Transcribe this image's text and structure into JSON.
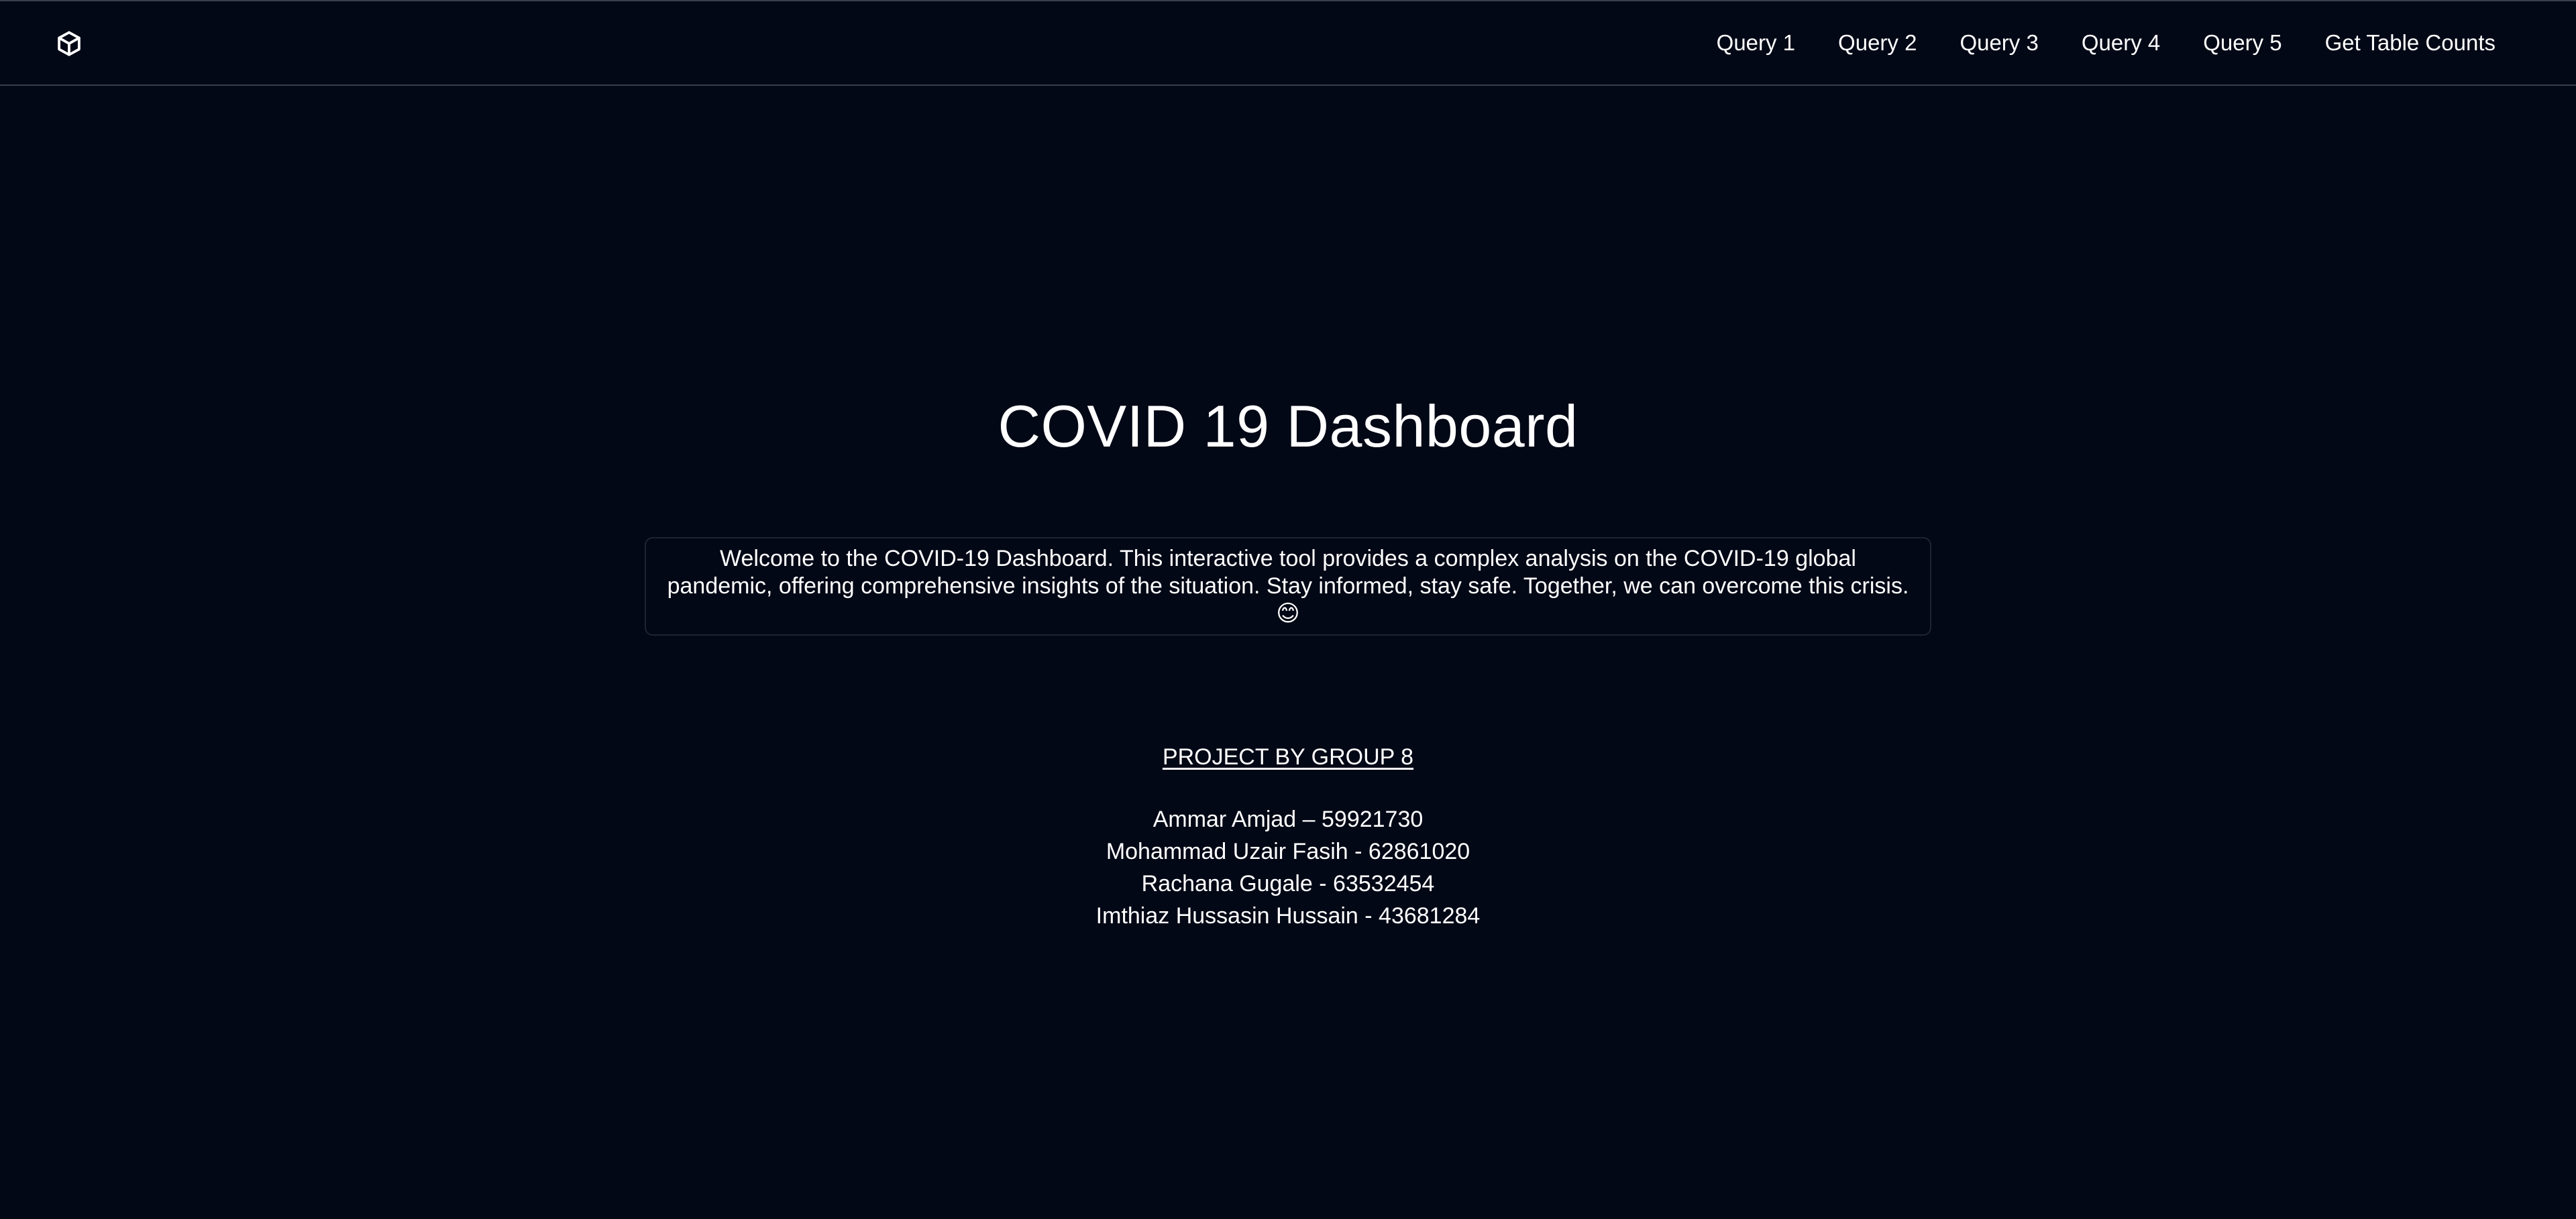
{
  "header": {
    "logo_icon": "cube-icon",
    "nav": [
      {
        "label": "Query 1"
      },
      {
        "label": "Query 2"
      },
      {
        "label": "Query 3"
      },
      {
        "label": "Query 4"
      },
      {
        "label": "Query 5"
      },
      {
        "label": "Get Table Counts"
      }
    ]
  },
  "main": {
    "title": "COVID 19 Dashboard",
    "welcome_text": "Welcome to the COVID-19 Dashboard. This interactive tool provides a complex analysis on the COVID-19 global pandemic, offering comprehensive insights of the situation. Stay informed, stay safe. Together, we can overcome this crisis. 😊",
    "group_heading": "PROJECT BY GROUP 8",
    "members": [
      "Ammar Amjad – 59921730",
      "Mohammad Uzair Fasih - 62861020",
      "Rachana Gugale - 63532454",
      "Imthiaz Hussasin Hussain - 43681284"
    ]
  },
  "colors": {
    "background": "#030816",
    "text": "#ffffff",
    "border": "#3a3f4b"
  }
}
